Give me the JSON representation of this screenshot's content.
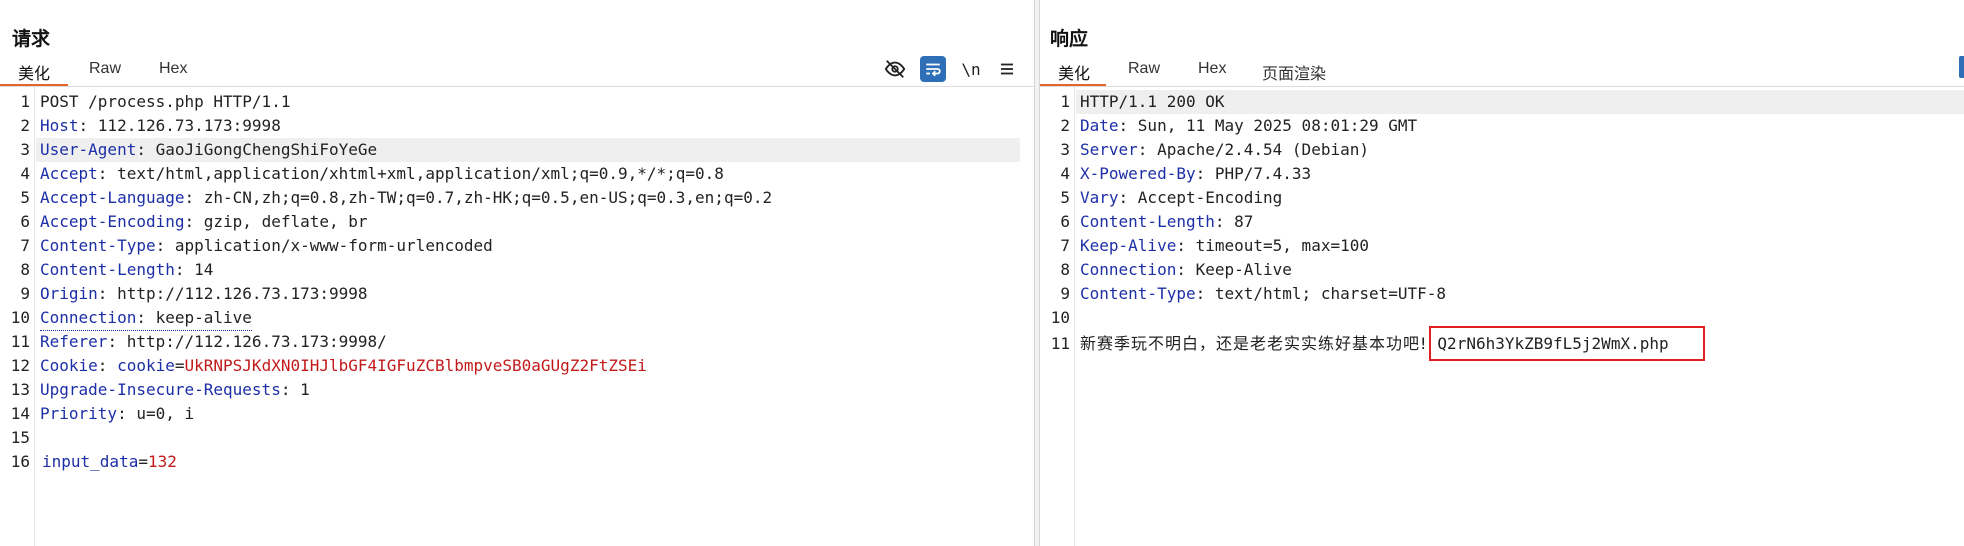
{
  "request": {
    "title": "请求",
    "tabs": [
      "美化",
      "Raw",
      "Hex"
    ],
    "tools": {
      "eye": "eye-off-icon",
      "wrap": "word-wrap-icon",
      "newline_label": "\\n",
      "menu": "menu-icon"
    },
    "lines": [
      {
        "n": "1",
        "k": "",
        "v": "POST /process.php HTTP/1.1"
      },
      {
        "n": "2",
        "k": "Host",
        "v": "112.126.73.173:9998"
      },
      {
        "n": "3",
        "k": "User-Agent",
        "v": "GaoJiGongChengShiFoYeGe"
      },
      {
        "n": "4",
        "k": "Accept",
        "v": "text/html,application/xhtml+xml,application/xml;q=0.9,*/*;q=0.8"
      },
      {
        "n": "5",
        "k": "Accept-Language",
        "v": "zh-CN,zh;q=0.8,zh-TW;q=0.7,zh-HK;q=0.5,en-US;q=0.3,en;q=0.2"
      },
      {
        "n": "6",
        "k": "Accept-Encoding",
        "v": "gzip, deflate, br"
      },
      {
        "n": "7",
        "k": "Content-Type",
        "v": "application/x-www-form-urlencoded"
      },
      {
        "n": "8",
        "k": "Content-Length",
        "v": "14"
      },
      {
        "n": "9",
        "k": "Origin",
        "v": "http://112.126.73.173:9998"
      },
      {
        "n": "10",
        "k": "Connection",
        "v": "keep-alive"
      },
      {
        "n": "11",
        "k": "Referer",
        "v": "http://112.126.73.173:9998/"
      },
      {
        "n": "12",
        "k": "Cookie",
        "cookie_name": "cookie",
        "cookie_value": "UkRNPSJKdXN0IHJlbGF4IGFuZCBlbmpveSB0aGUgZ2FtZSEi"
      },
      {
        "n": "13",
        "k": "Upgrade-Insecure-Requests",
        "v": "1"
      },
      {
        "n": "14",
        "k": "Priority",
        "v": "u=0, i"
      },
      {
        "n": "15",
        "k": "",
        "v": ""
      },
      {
        "n": "16",
        "param_name": "input_data",
        "param_value": "132"
      }
    ]
  },
  "response": {
    "title": "响应",
    "tabs": [
      "美化",
      "Raw",
      "Hex",
      "页面渲染"
    ],
    "lines": [
      {
        "n": "1",
        "k": "",
        "v": "HTTP/1.1 200 OK"
      },
      {
        "n": "2",
        "k": "Date",
        "v": "Sun, 11 May 2025 08:01:29 GMT"
      },
      {
        "n": "3",
        "k": "Server",
        "v": "Apache/2.4.54 (Debian)"
      },
      {
        "n": "4",
        "k": "X-Powered-By",
        "v": "PHP/7.4.33"
      },
      {
        "n": "5",
        "k": "Vary",
        "v": "Accept-Encoding"
      },
      {
        "n": "6",
        "k": "Content-Length",
        "v": "87"
      },
      {
        "n": "7",
        "k": "Keep-Alive",
        "v": "timeout=5, max=100"
      },
      {
        "n": "8",
        "k": "Connection",
        "v": "Keep-Alive"
      },
      {
        "n": "9",
        "k": "Content-Type",
        "v": "text/html; charset=UTF-8"
      },
      {
        "n": "10",
        "k": "",
        "v": ""
      },
      {
        "n": "11",
        "body_text": "新赛季玩不明白，还是老老实实练好基本功吧!",
        "highlight": "Q2rN6h3YkZB9fL5j2WmX.php"
      }
    ]
  },
  "colors": {
    "accent": "#e8632a",
    "header_key": "#1c2fa6",
    "cookie_value": "#c21a1a",
    "highlight_box": "#e02020",
    "wrap_button": "#2f6fb8"
  }
}
